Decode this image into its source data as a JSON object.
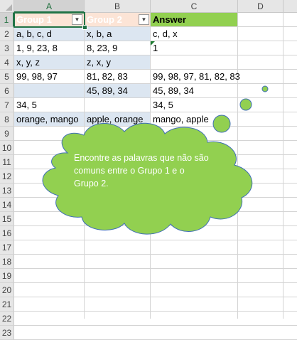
{
  "columns": [
    "A",
    "B",
    "C",
    "D"
  ],
  "rows": [
    "1",
    "2",
    "3",
    "4",
    "5",
    "6",
    "7",
    "8",
    "9",
    "10",
    "11",
    "12",
    "13",
    "14",
    "15",
    "16",
    "17",
    "18",
    "19",
    "20",
    "21",
    "22",
    "23"
  ],
  "table": {
    "header": {
      "group1": "Group 1",
      "group2": "Group 2",
      "answer": "Answer"
    },
    "data": [
      {
        "a": "a, b, c, d",
        "b": "x, b, a",
        "c": "c, d, x"
      },
      {
        "a": "1, 9, 23, 8",
        "b": "8, 23, 9",
        "c": "1"
      },
      {
        "a": "x, y, z",
        "b": "z, x, y",
        "c": ""
      },
      {
        "a": "99, 98, 97",
        "b": "81, 82, 83",
        "c": "99, 98, 97, 81, 82, 83"
      },
      {
        "a": "",
        "b": "45, 89, 34",
        "c": "45, 89, 34"
      },
      {
        "a": "34, 5",
        "b": "",
        "c": "34, 5"
      },
      {
        "a": "orange, mango",
        "b": "apple, orange",
        "c": "mango, apple"
      }
    ]
  },
  "callout": {
    "text": "Encontre as palavras que não são comuns entre o Grupo 1 e o Grupo 2.",
    "fill_color": "#92d050",
    "outline_color": "#3f6fb5"
  },
  "colors": {
    "header_group": "#fce4d6",
    "header_answer": "#92d050",
    "band": "#dce6f1",
    "selection": "#217346"
  }
}
